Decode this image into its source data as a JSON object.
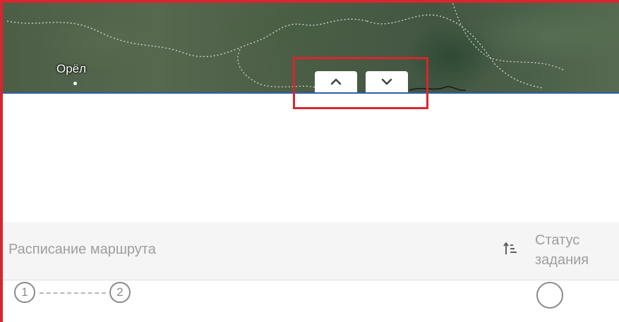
{
  "map": {
    "city": "Орёл"
  },
  "nav": {
    "up_icon": "chevron-up-icon",
    "down_icon": "chevron-down-icon"
  },
  "table": {
    "col_route": "Расписание маршрута",
    "sort_icon": "sort-ascending-icon",
    "col_status_line1": "Статус",
    "col_status_line2": "задания",
    "row": {
      "step_start": "1",
      "step_end": "2"
    }
  },
  "colors": {
    "accent_frame": "#d8262f",
    "map_border": "#2e5fa8",
    "muted_text": "#9e9e9e"
  }
}
